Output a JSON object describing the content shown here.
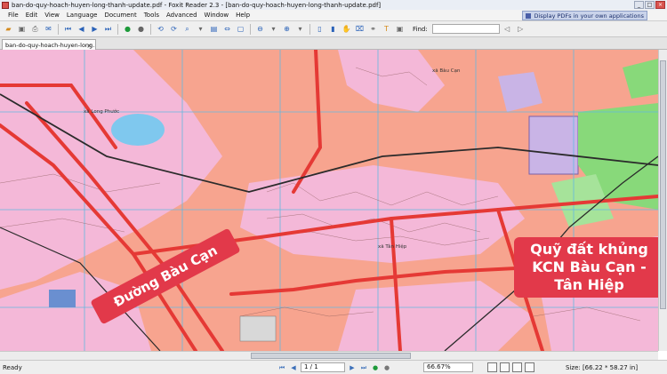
{
  "window": {
    "title": "ban-do-quy-hoach-huyen-long-thanh-update.pdf - Foxit Reader 2.3 - [ban-do-quy-hoach-huyen-long-thanh-update.pdf]",
    "btn_min": "_",
    "btn_max": "□",
    "btn_close": "×"
  },
  "menu": {
    "items": [
      "File",
      "Edit",
      "View",
      "Language",
      "Document",
      "Tools",
      "Advanced",
      "Window",
      "Help"
    ],
    "promo": "Display PDFs in your own applications"
  },
  "toolbar": {
    "find_label": "Find:"
  },
  "tab": {
    "label": "ban-do-quy-hoach-huyen-long...",
    "close": "×"
  },
  "map": {
    "labels": {
      "bau_can": "xã Bàu Cạn",
      "long_phuoc": "xã Long Phước",
      "tan_hiep": "xã Tân Hiệp"
    },
    "callouts": {
      "road": "Đường Bàu Cạn",
      "area_line1": "Quỹ đất khủng",
      "area_line2": "KCN Bàu Cạn -",
      "area_line3": "Tân Hiệp"
    }
  },
  "status": {
    "ready": "Ready",
    "page": "1 / 1",
    "zoom": "66.67%",
    "size": "Size: [66.22 * 58.27 in]"
  },
  "colors": {
    "land_salmon": "#f7a48f",
    "land_pink": "#f4b8d8",
    "land_purple": "#c9b4e6",
    "green_zone": "#88d97a",
    "road_red": "#e53935",
    "callout_bg": "#e2394a"
  }
}
